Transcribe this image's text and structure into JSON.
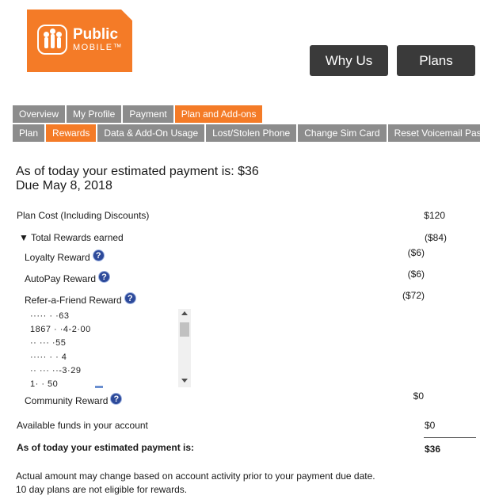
{
  "logo": {
    "line1": "Public",
    "line2": "MOBILE™"
  },
  "top_buttons": {
    "why_us": "Why Us",
    "plans": "Plans"
  },
  "tabs_primary": [
    {
      "label": "Overview"
    },
    {
      "label": "My Profile"
    },
    {
      "label": "Payment"
    },
    {
      "label": "Plan and Add-ons",
      "active": true
    }
  ],
  "tabs_secondary": [
    {
      "label": "Plan"
    },
    {
      "label": "Rewards",
      "active": true
    },
    {
      "label": "Data & Add-On Usage"
    },
    {
      "label": "Lost/Stolen Phone"
    },
    {
      "label": "Change Sim Card"
    },
    {
      "label": "Reset Voicemail Password"
    }
  ],
  "headline": {
    "line1": "As of today your estimated payment is: $36",
    "line2": "Due May 8, 2018"
  },
  "plan_cost": {
    "label": "Plan Cost (Including Discounts)",
    "value": "$120"
  },
  "total_rewards": {
    "label": "▼ Total Rewards earned",
    "value": "($84)"
  },
  "loyalty": {
    "label": "Loyalty Reward",
    "value": "($6)"
  },
  "autopay": {
    "label": "AutoPay Reward",
    "value": "($6)"
  },
  "refer": {
    "label": "Refer-a-Friend Reward",
    "value": "($72)"
  },
  "referrals": [
    {
      "text": "   ·····  ·  ·63"
    },
    {
      "text": "  1867 ·  ·4-2·00"
    },
    {
      "text": "  ··  ···   ·55"
    },
    {
      "text": "  ·····  ·  ·  4"
    },
    {
      "text": "  ··  ···  ··-3·29"
    },
    {
      "text": "  1·  · 50"
    }
  ],
  "community": {
    "label": "Community Reward",
    "value": "$0"
  },
  "available": {
    "label": "Available funds in your account",
    "value": "$0"
  },
  "estimated": {
    "label": "As of today your estimated payment is:",
    "value": "$36"
  },
  "notes": {
    "line1": "Actual amount may change based on account activity prior to your payment due date.",
    "line2": "10 day plans are not eligible for rewards."
  },
  "help_glyph": "?",
  "colors": {
    "brand_orange": "#f47b27",
    "tab_gray": "#8c8c8c",
    "button_dark": "#3a3a3a",
    "help_blue": "#2d4a9a"
  }
}
